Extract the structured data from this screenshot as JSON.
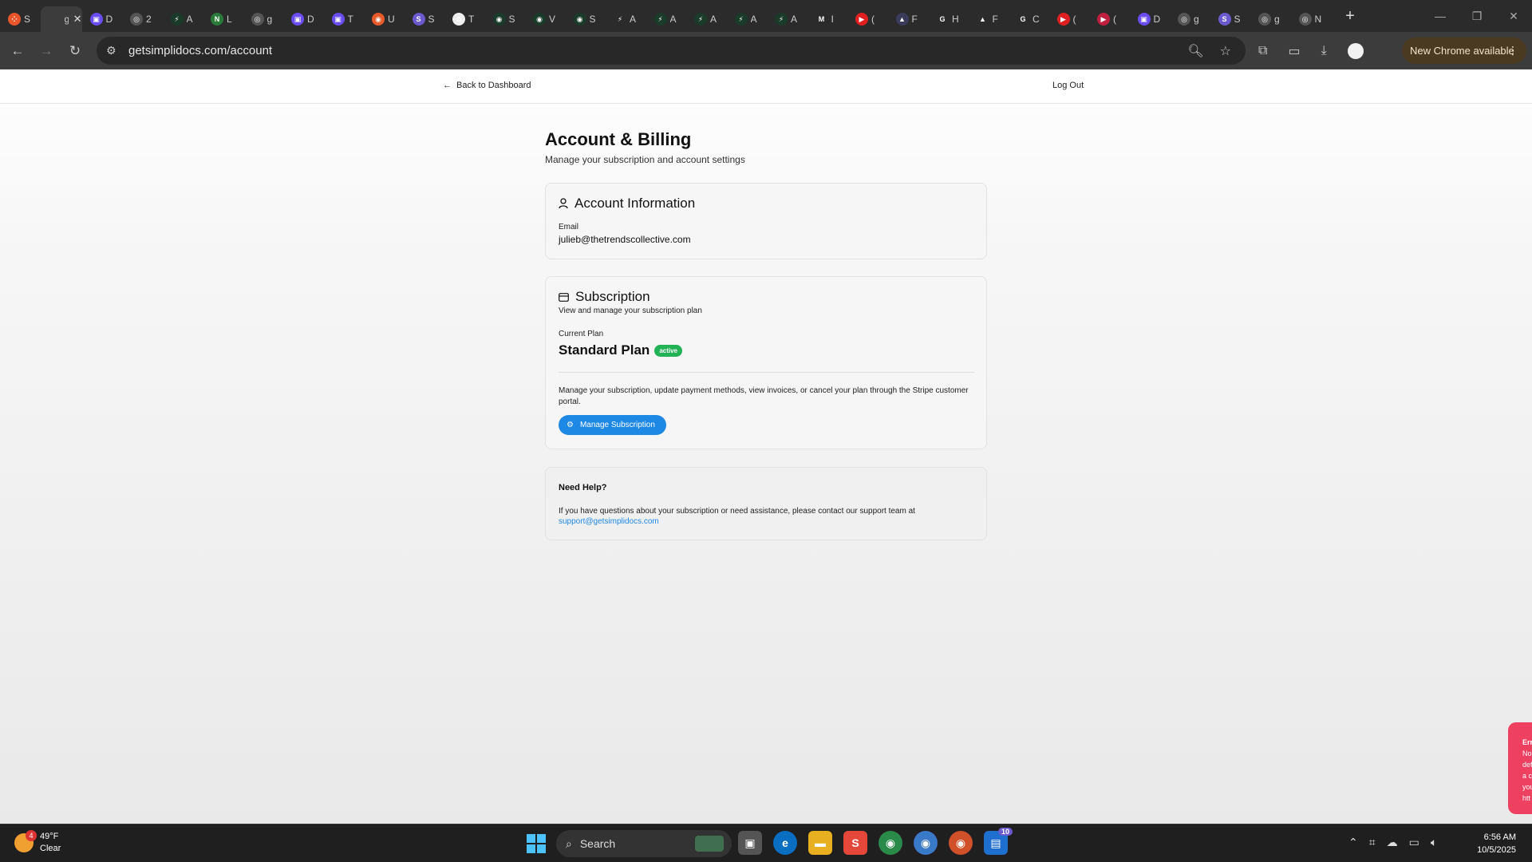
{
  "browser": {
    "tabs": [
      {
        "letter": "S",
        "color": "#e8552a",
        "glyph": "⁘"
      },
      {
        "letter": "g",
        "color": "#3c3c3c",
        "glyph": "",
        "active": true
      },
      {
        "letter": "D",
        "color": "#6b4cf0",
        "glyph": "▣"
      },
      {
        "letter": "2",
        "color": "#555555",
        "glyph": "◎"
      },
      {
        "letter": "A",
        "color": "#1a3a2a",
        "glyph": "⚡"
      },
      {
        "letter": "L",
        "color": "#2a7a3a",
        "glyph": "N"
      },
      {
        "letter": "g",
        "color": "#555555",
        "glyph": "◎"
      },
      {
        "letter": "D",
        "color": "#6b4cf0",
        "glyph": "▣"
      },
      {
        "letter": "T",
        "color": "#6b4cf0",
        "glyph": "▣"
      },
      {
        "letter": "U",
        "color": "#e85a2a",
        "glyph": "◉"
      },
      {
        "letter": "S",
        "color": "#6a5acd",
        "glyph": "S"
      },
      {
        "letter": "T",
        "color": "#eeeeee",
        "glyph": "✿"
      },
      {
        "letter": "S",
        "color": "#1a3a2a",
        "glyph": "◉"
      },
      {
        "letter": "V",
        "color": "#1a3a2a",
        "glyph": "◉"
      },
      {
        "letter": "S",
        "color": "#1a3a2a",
        "glyph": "◉"
      },
      {
        "letter": "A",
        "color": "#2b2b2b",
        "glyph": "⚡"
      },
      {
        "letter": "A",
        "color": "#1a3a2a",
        "glyph": "⚡"
      },
      {
        "letter": "A",
        "color": "#1a3a2a",
        "glyph": "⚡"
      },
      {
        "letter": "A",
        "color": "#1a3a2a",
        "glyph": "⚡"
      },
      {
        "letter": "A",
        "color": "#1a3a2a",
        "glyph": "⚡"
      },
      {
        "letter": "I",
        "color": "#2b2b2b",
        "glyph": "M"
      },
      {
        "letter": "(",
        "color": "#e02020",
        "glyph": "▶"
      },
      {
        "letter": "F",
        "color": "#3a3a5a",
        "glyph": "▲"
      },
      {
        "letter": "H",
        "color": "#2b2b2b",
        "glyph": "G"
      },
      {
        "letter": "F",
        "color": "#2b2b2b",
        "glyph": "▲"
      },
      {
        "letter": "C",
        "color": "#2b2b2b",
        "glyph": "G"
      },
      {
        "letter": "(",
        "color": "#e02020",
        "glyph": "▶"
      },
      {
        "letter": "(",
        "color": "#c02040",
        "glyph": "▶"
      },
      {
        "letter": "D",
        "color": "#6b4cf0",
        "glyph": "▣"
      },
      {
        "letter": "g",
        "color": "#555555",
        "glyph": "◎"
      },
      {
        "letter": "S",
        "color": "#6a5acd",
        "glyph": "S"
      },
      {
        "letter": "g",
        "color": "#555555",
        "glyph": "◎"
      },
      {
        "letter": "N",
        "color": "#555555",
        "glyph": "◎"
      }
    ],
    "url": "getsimplidocs.com/account",
    "update_label": "New Chrome available"
  },
  "page": {
    "back_label": "Back to Dashboard",
    "logout_label": "Log Out",
    "title": "Account & Billing",
    "subtitle": "Manage your subscription and account settings",
    "account": {
      "heading": "Account Information",
      "email_label": "Email",
      "email_value": "julieb@thetrendscollective.com"
    },
    "subscription": {
      "heading": "Subscription",
      "subheading": "View and manage your subscription plan",
      "plan_label": "Current Plan",
      "plan_name": "Standard Plan",
      "status": "active",
      "description": "Manage your subscription, update payment methods, view invoices, or cancel your plan through the Stripe customer portal.",
      "button_label": "Manage Subscription"
    },
    "help": {
      "heading": "Need Help?",
      "text": "If you have questions about your subscription or need assistance, please contact our support team at",
      "email": "support@getsimplidocs.com"
    },
    "toast_lines": [
      "Err",
      "No",
      "def",
      "a c",
      "you",
      "htt"
    ]
  },
  "taskbar": {
    "weather_temp": "49°F",
    "weather_desc": "Clear",
    "weather_badge": "4",
    "search_placeholder": "Search",
    "app_badge": "10",
    "time": "6:56 AM",
    "date": "10/5/2025"
  }
}
